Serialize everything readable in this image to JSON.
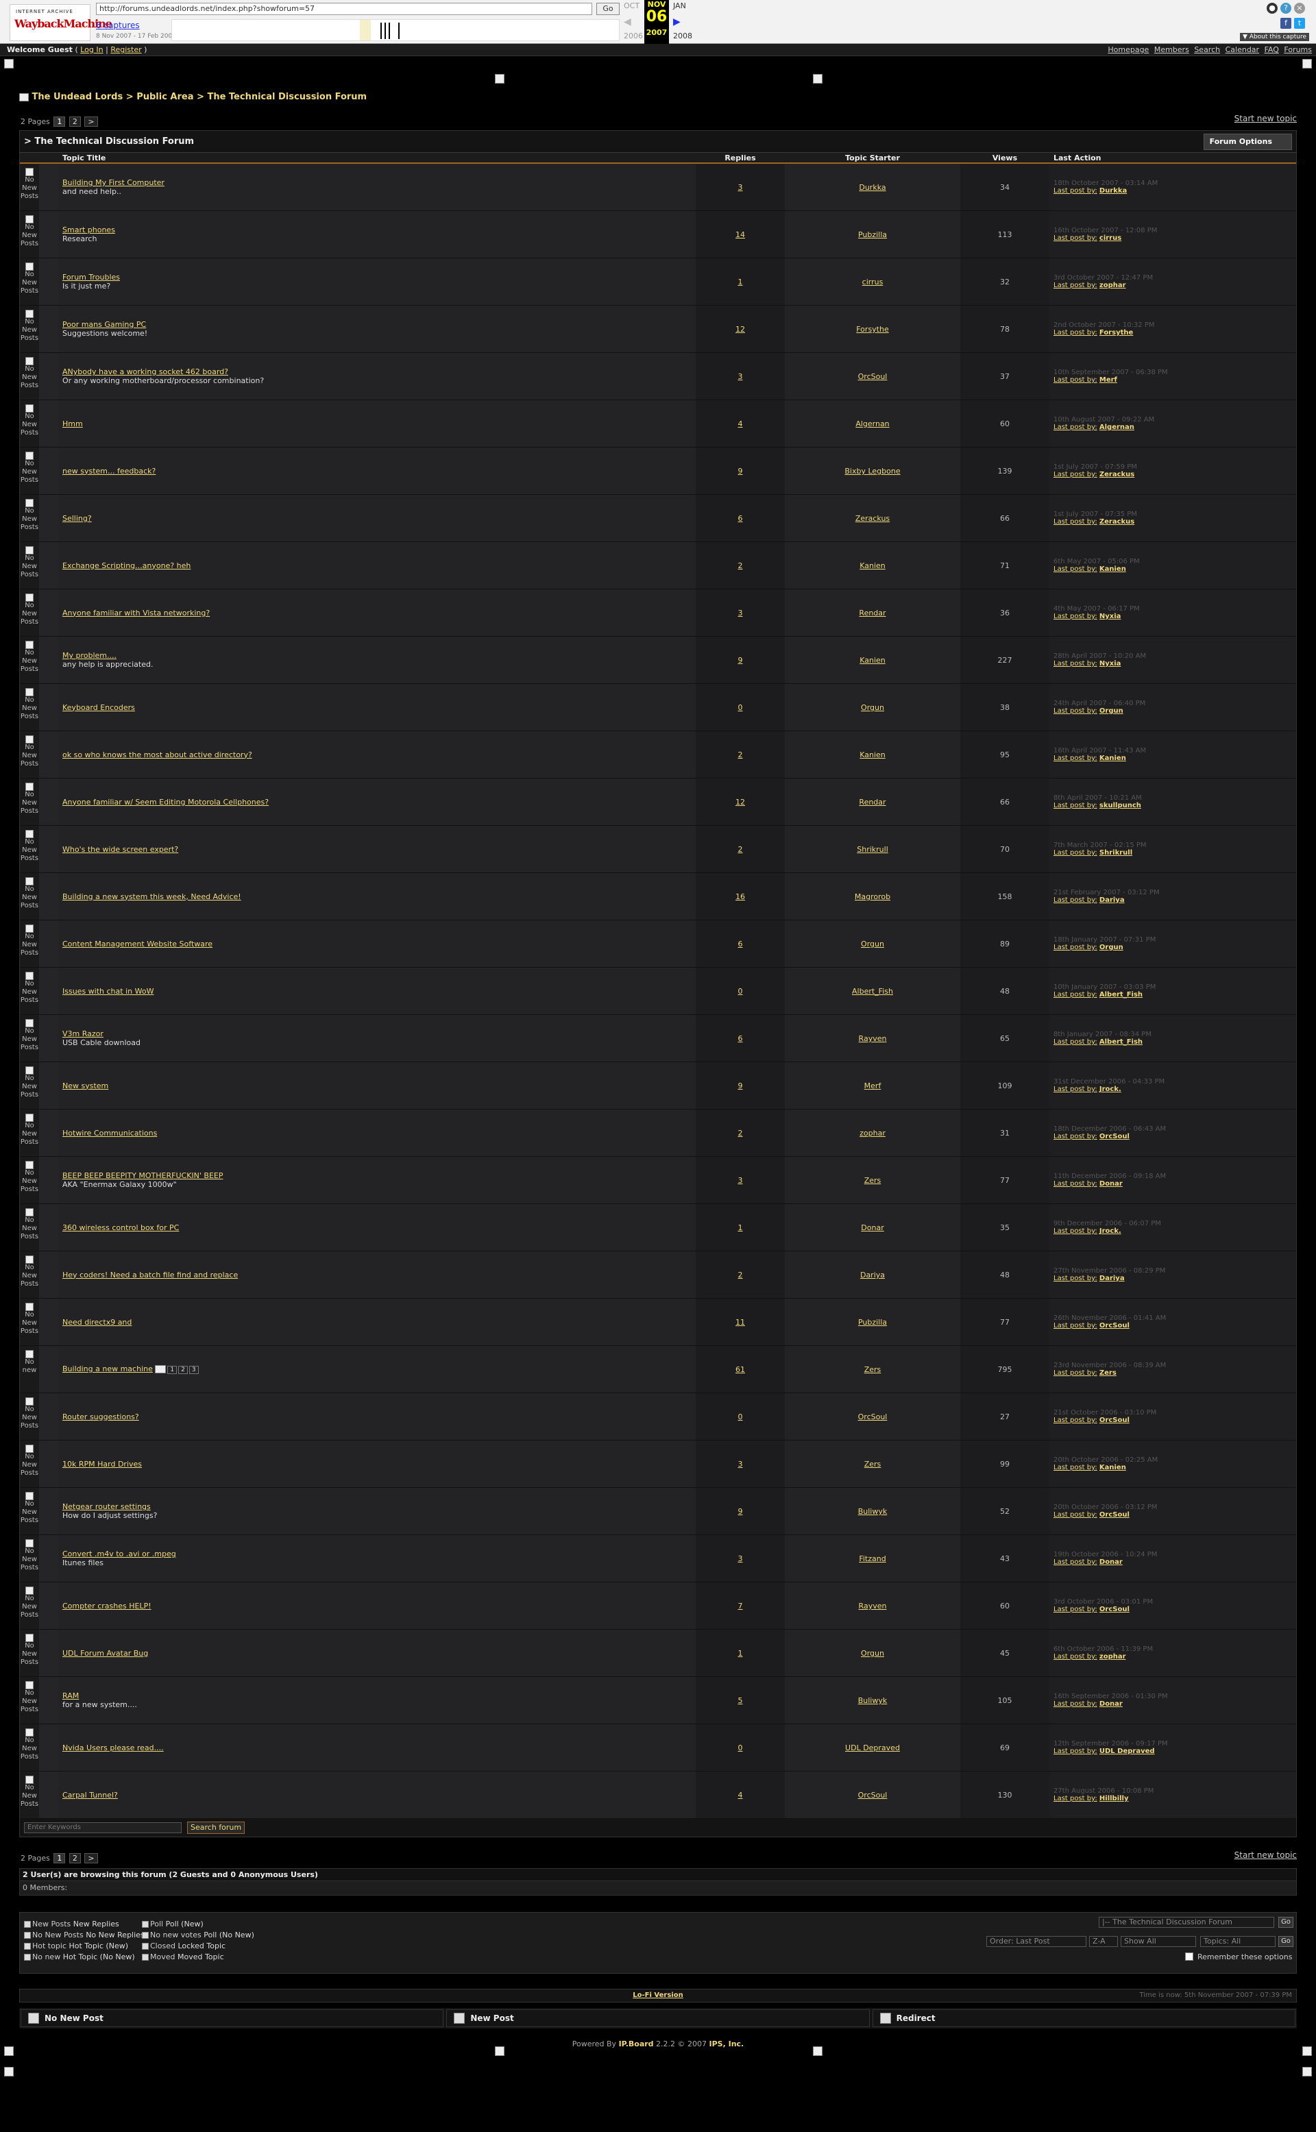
{
  "wayback": {
    "logo_top": "INTERNET ARCHIVE",
    "logo_main": "WaybackMachine",
    "url": "http://forums.undeadlords.net/index.php?showforum=57",
    "go": "Go",
    "captures": "6 captures",
    "range": "8 Nov 2007 - 17 Feb 2009",
    "prev_month": "OCT",
    "cur_month": "NOV",
    "next_month": "JAN",
    "day": "06",
    "prev_year": "2006",
    "cur_year": "2007",
    "next_year": "2008",
    "about": "▼ About this capture"
  },
  "userbar": {
    "welcome": "Welcome Guest",
    "open": "(",
    "login": "Log In",
    "sep": "|",
    "register": "Register",
    "close": ")"
  },
  "topnav": [
    "Homepage",
    "Members",
    "Search",
    "Calendar",
    "FAQ",
    "Forums"
  ],
  "breadcrumb": {
    "a": "The Undead Lords",
    "sep1": ">",
    "b": "Public Area",
    "sep2": ">",
    "c": "The Technical Discussion Forum"
  },
  "pager": {
    "label": "2 Pages",
    "p1": "1",
    "p2": "2",
    "next": ">"
  },
  "start_topic": "Start new topic",
  "forum": {
    "title": "> The Technical Discussion Forum",
    "options": "Forum Options",
    "headers": {
      "title": "Topic Title",
      "replies": "Replies",
      "starter": "Topic Starter",
      "views": "Views",
      "last": "Last Action"
    },
    "no_new": "No New Posts",
    "last_prefix": "Last post by:"
  },
  "topics": [
    {
      "title": "Building My First Computer",
      "desc": "and need help..",
      "replies": "3",
      "starter": "Durkka",
      "views": "34",
      "date": "18th October 2007 - 03:14 AM",
      "last": "Durkka"
    },
    {
      "title": "Smart phones",
      "desc": "Research",
      "replies": "14",
      "starter": "Pubzilla",
      "views": "113",
      "date": "16th October 2007 - 12:08 PM",
      "last": "cirrus"
    },
    {
      "title": "Forum Troubles",
      "desc": "Is it just me?",
      "replies": "1",
      "starter": "cirrus",
      "views": "32",
      "date": "3rd October 2007 - 12:47 PM",
      "last": "zophar"
    },
    {
      "title": "Poor mans Gaming PC",
      "desc": "Suggestions welcome!",
      "replies": "12",
      "starter": "Forsythe",
      "views": "78",
      "date": "2nd October 2007 - 10:32 PM",
      "last": "Forsythe"
    },
    {
      "title": "ANybody have a working socket 462 board?",
      "desc": "Or any working motherboard/processor combination?",
      "replies": "3",
      "starter": "OrcSoul",
      "views": "37",
      "date": "10th September 2007 - 06:38 PM",
      "last": "Merf"
    },
    {
      "title": "Hmm",
      "desc": "",
      "replies": "4",
      "starter": "Algernan",
      "views": "60",
      "date": "10th August 2007 - 09:22 AM",
      "last": "Algernan"
    },
    {
      "title": "new system... feedback?",
      "desc": "",
      "replies": "9",
      "starter": "Bixby Legbone",
      "views": "139",
      "date": "1st July 2007 - 07:59 PM",
      "last": "Zerackus"
    },
    {
      "title": "Selling?",
      "desc": "",
      "replies": "6",
      "starter": "Zerackus",
      "views": "66",
      "date": "1st July 2007 - 07:35 PM",
      "last": "Zerackus"
    },
    {
      "title": "Exchange Scripting...anyone? heh",
      "desc": "",
      "replies": "2",
      "starter": "Kanien",
      "views": "71",
      "date": "6th May 2007 - 05:06 PM",
      "last": "Kanien"
    },
    {
      "title": "Anyone familiar with Vista networking?",
      "desc": "",
      "replies": "3",
      "starter": "Rendar",
      "views": "36",
      "date": "4th May 2007 - 06:17 PM",
      "last": "Nyxia"
    },
    {
      "title": "My problem....",
      "desc": "any help is appreciated.",
      "replies": "9",
      "starter": "Kanien",
      "views": "227",
      "date": "28th April 2007 - 10:20 AM",
      "last": "Nyxia"
    },
    {
      "title": "Keyboard Encoders",
      "desc": "",
      "replies": "0",
      "starter": "Orgun",
      "views": "38",
      "date": "24th April 2007 - 06:40 PM",
      "last": "Orgun"
    },
    {
      "title": "ok so who knows the most about active directory?",
      "desc": "",
      "replies": "2",
      "starter": "Kanien",
      "views": "95",
      "date": "16th April 2007 - 11:43 AM",
      "last": "Kanien"
    },
    {
      "title": "Anyone familiar w/ Seem Editing Motorola Cellphones?",
      "desc": "",
      "replies": "12",
      "starter": "Rendar",
      "views": "66",
      "date": "8th April 2007 - 10:21 AM",
      "last": "skullpunch"
    },
    {
      "title": "Who's the wide screen expert?",
      "desc": "",
      "replies": "2",
      "starter": "Shrikrull",
      "views": "70",
      "date": "7th March 2007 - 02:15 PM",
      "last": "Shrikrull"
    },
    {
      "title": "Building a new system this week, Need Advice!",
      "desc": "",
      "replies": "16",
      "starter": "Magrorob",
      "views": "158",
      "date": "21st February 2007 - 03:12 PM",
      "last": "Dariya"
    },
    {
      "title": "Content Management Website Software",
      "desc": "",
      "replies": "6",
      "starter": "Orgun",
      "views": "89",
      "date": "18th January 2007 - 07:31 PM",
      "last": "Orgun"
    },
    {
      "title": "Issues with chat in WoW",
      "desc": "",
      "replies": "0",
      "starter": "Albert_Fish",
      "views": "48",
      "date": "10th January 2007 - 03:03 PM",
      "last": "Albert_Fish"
    },
    {
      "title": "V3m Razor",
      "desc": "USB Cable download",
      "replies": "6",
      "starter": "Rayven",
      "views": "65",
      "date": "8th January 2007 - 08:34 PM",
      "last": "Albert_Fish"
    },
    {
      "title": "New system",
      "desc": "",
      "replies": "9",
      "starter": "Merf",
      "views": "109",
      "date": "31st December 2006 - 04:33 PM",
      "last": "Jrock."
    },
    {
      "title": "Hotwire Communications",
      "desc": "",
      "replies": "2",
      "starter": "zophar",
      "views": "31",
      "date": "18th December 2006 - 06:43 AM",
      "last": "OrcSoul"
    },
    {
      "title": "BEEP BEEP BEEPITY MOTHERFUCKIN' BEEP",
      "desc": "AKA \"Enermax Galaxy 1000w\"",
      "replies": "3",
      "starter": "Zers",
      "views": "77",
      "date": "11th December 2006 - 09:18 AM",
      "last": "Donar"
    },
    {
      "title": "360 wireless control box for PC",
      "desc": "",
      "replies": "1",
      "starter": "Donar",
      "views": "35",
      "date": "9th December 2006 - 06:07 PM",
      "last": "Jrock."
    },
    {
      "title": "Hey coders! Need a batch file find and replace",
      "desc": "",
      "replies": "2",
      "starter": "Dariya",
      "views": "48",
      "date": "27th November 2006 - 08:29 PM",
      "last": "Dariya"
    },
    {
      "title": "Need directx9 and",
      "desc": "",
      "replies": "11",
      "starter": "Pubzilla",
      "views": "77",
      "date": "26th November 2006 - 01:41 AM",
      "last": "OrcSoul"
    },
    {
      "title": "Building a new machine",
      "desc": "",
      "replies": "61",
      "starter": "Zers",
      "views": "795",
      "date": "23rd November 2006 - 08:39 AM",
      "last": "Zers",
      "pages": [
        "1",
        "2",
        "3"
      ],
      "icon": "No new"
    },
    {
      "title": "Router suggestions?",
      "desc": "",
      "replies": "0",
      "starter": "OrcSoul",
      "views": "27",
      "date": "21st October 2006 - 03:10 PM",
      "last": "OrcSoul"
    },
    {
      "title": "10k RPM Hard Drives",
      "desc": "",
      "replies": "3",
      "starter": "Zers",
      "views": "99",
      "date": "20th October 2006 - 02:25 AM",
      "last": "Kanien"
    },
    {
      "title": "Netgear router settings",
      "desc": "How do I adjust settings?",
      "replies": "9",
      "starter": "Buliwyk",
      "views": "52",
      "date": "20th October 2006 - 03:12 PM",
      "last": "OrcSoul"
    },
    {
      "title": "Convert .m4v to .avi or .mpeg",
      "desc": "Itunes files",
      "replies": "3",
      "starter": "Fitzand",
      "views": "43",
      "date": "19th October 2006 - 10:24 PM",
      "last": "Donar"
    },
    {
      "title": "Compter crashes HELP!",
      "desc": "",
      "replies": "7",
      "starter": "Rayven",
      "views": "60",
      "date": "3rd October 2006 - 03:01 PM",
      "last": "OrcSoul"
    },
    {
      "title": "UDL Forum Avatar Bug",
      "desc": "",
      "replies": "1",
      "starter": "Orgun",
      "views": "45",
      "date": "6th October 2006 - 11:39 PM",
      "last": "zophar"
    },
    {
      "title": "RAM",
      "desc": "for a new system....",
      "replies": "5",
      "starter": "Buliwyk",
      "views": "105",
      "date": "16th September 2006 - 01:30 PM",
      "last": "Donar"
    },
    {
      "title": "Nvida Users please read....",
      "desc": "",
      "replies": "0",
      "starter": "UDL Depraved",
      "views": "69",
      "date": "12th September 2006 - 09:17 PM",
      "last": "UDL Depraved"
    },
    {
      "title": "Carpal Tunnel?",
      "desc": "",
      "replies": "4",
      "starter": "OrcSoul",
      "views": "130",
      "date": "27th August 2006 - 10:08 PM",
      "last": "Hillbilly"
    }
  ],
  "search": {
    "placeholder": "Enter Keywords",
    "button": "Search forum"
  },
  "active": {
    "header": "2 User(s) are browsing this forum (2 Guests and 0 Anonymous Users)",
    "members": "0 Members:"
  },
  "legend": {
    "l1": "New Posts",
    "l1t": "New Replies",
    "l2": "No New Posts",
    "l2t": "No New Replies",
    "l3": "Hot topic",
    "l3t": "Hot Topic (New)",
    "l4": "No new",
    "l4t": "Hot Topic (No New)",
    "m1": "Poll",
    "m1t": "Poll (New)",
    "m2": "No new votes",
    "m2t": "Poll (No New)",
    "m3": "Closed",
    "m3t": "Locked Topic",
    "m4": "Moved",
    "m4t": "Moved Topic"
  },
  "jump": {
    "forum": "|-- The Technical Discussion Forum",
    "go": "Go"
  },
  "sort": {
    "order": "Order: Last Post",
    "dir": "Z-A",
    "show": "Show All",
    "topics": "Topics: All",
    "remember": "Remember these options"
  },
  "lofi": {
    "link": "Lo-Fi Version",
    "time": "Time is now: 5th November 2007 - 07:39 PM"
  },
  "legend2": {
    "a": "No New Post",
    "b": "New Post",
    "c": "Redirect"
  },
  "footer": {
    "powered": "Powered By",
    "board": "IP.Board",
    "ver": "2.2.2 © 2007",
    "ips": "IPS, Inc."
  }
}
